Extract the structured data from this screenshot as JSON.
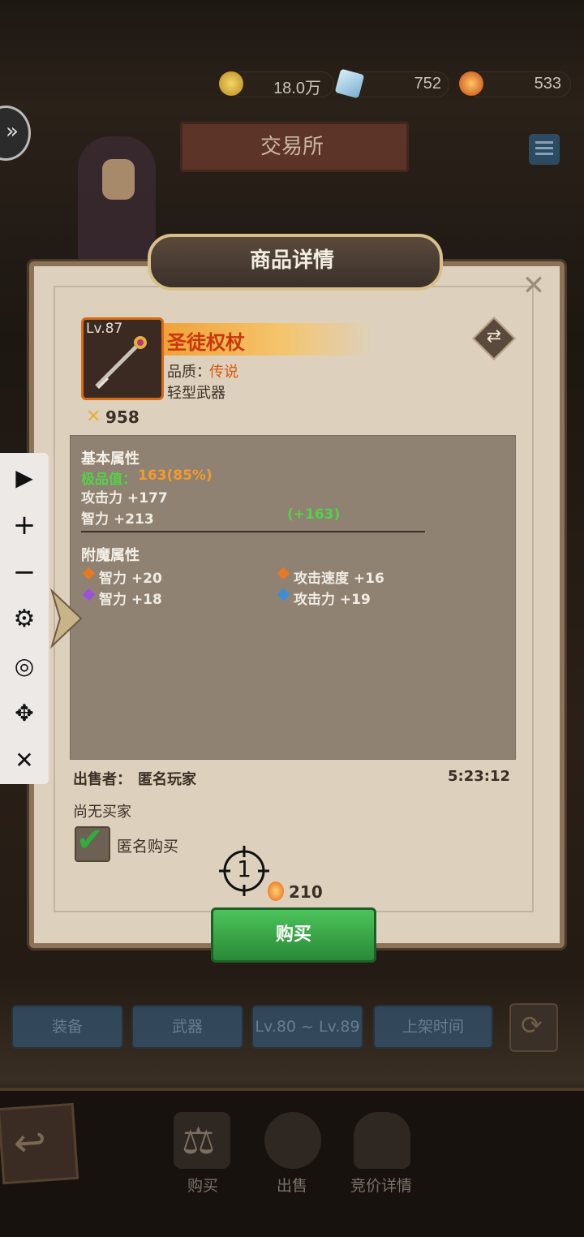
{
  "currency": {
    "gold": "18.0万",
    "diamond": "752",
    "amber": "533"
  },
  "header": {
    "title": "交易所"
  },
  "dialog": {
    "title": "商品详情",
    "close_glyph": "✕",
    "item": {
      "level": "Lv.87",
      "name": "圣徒权杖",
      "quality_label": "品质：",
      "quality_value": "传说",
      "type": "轻型武器",
      "power": "958"
    },
    "basic": {
      "heading": "基本属性",
      "quality_score_label": "极品值：",
      "quality_score_value": "163(85%)",
      "attack": "攻击力 +177",
      "intellect": "智力 +213",
      "intellect_bonus": "(+163)"
    },
    "enchant": {
      "heading": "附魔属性",
      "entries": [
        {
          "text": "智力 +20",
          "gem_color": "#e47a22"
        },
        {
          "text": "攻击速度 +16",
          "gem_color": "#e47a22"
        },
        {
          "text": "智力 +18",
          "gem_color": "#9a52d9"
        },
        {
          "text": "攻击力 +19",
          "gem_color": "#3b8fd9"
        }
      ]
    },
    "seller_label": "出售者：",
    "seller_value": "匿名玩家",
    "timer": "5:23:12",
    "buyer_status": "尚无买家",
    "anonymous_buy": "匿名购买",
    "price": "210",
    "buy_button": "购买"
  },
  "filters": [
    "装备",
    "武器",
    "Lv.80 ~ Lv.89",
    "上架时间"
  ],
  "bottom_nav": [
    "购买",
    "出售",
    "竞价详情"
  ],
  "toolbar": {
    "items": [
      "play-icon",
      "zoom-in-icon",
      "zoom-out-icon",
      "settings-icon",
      "hide-icon",
      "move-icon",
      "close-icon"
    ],
    "glyphs": [
      "▶",
      "+",
      "−",
      "⚙",
      "◎",
      "✥",
      "✕"
    ]
  },
  "crosshair_label": "1"
}
